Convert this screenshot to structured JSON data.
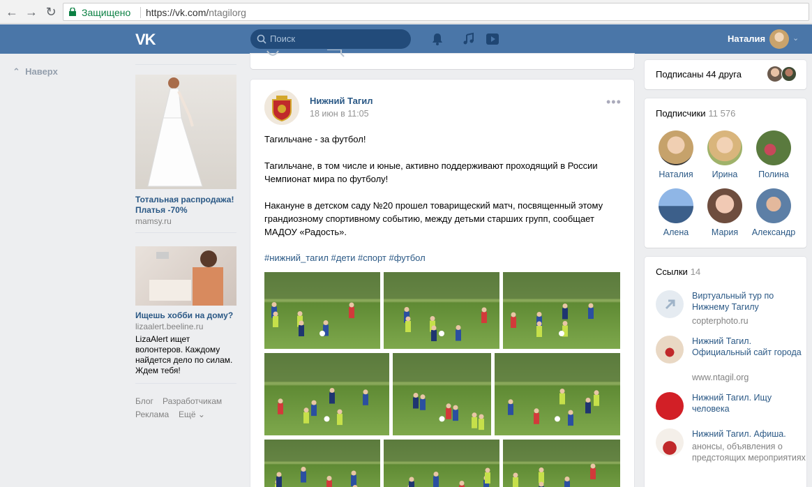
{
  "browser": {
    "secure_label": "Защищено",
    "url_host": "https://vk.com/",
    "url_path": "ntagilorg"
  },
  "header": {
    "logo": "VK",
    "search_placeholder": "Поиск",
    "user_name": "Наталия"
  },
  "leftnav": {
    "up_label": "Наверх"
  },
  "ads": [
    {
      "title": "Тотальная распродажа! Платья -70%",
      "domain": "mamsy.ru",
      "text": ""
    },
    {
      "title": "Ищешь хобби на дому?",
      "domain": "lizaalert.beeline.ru",
      "text": "LizaAlert ищет волонтеров. Каждому найдется дело по силам. Ждем тебя!"
    }
  ],
  "footer": {
    "blog": "Блог",
    "developers": "Разработчикам",
    "ads": "Реклама",
    "more": "Ещё"
  },
  "post": {
    "author": "Нижний Тагил",
    "date": "18 июн в 11:05",
    "more": "•••",
    "paragraphs": [
      "Тагильчане - за футбол!",
      "Тагильчане, в том числе и юные, активно поддерживают проходящий в России Чемпионат мира по футболу!",
      "Накануне в детском саду №20 прошел товарищеский матч, посвященный этому грандиозному спортивному событию, между детьми старших групп, сообщает МАДОУ «Радость»."
    ],
    "hashtags": "#нижний_тагил #дети #спорт #футбол",
    "photo_count": 9
  },
  "friends": {
    "label": "Подписаны 44 друга"
  },
  "subscribers": {
    "label": "Подписчики",
    "count": "11 576",
    "people": [
      "Наталия",
      "Ирина",
      "Полина",
      "Алена",
      "Мария",
      "Александр"
    ]
  },
  "links": {
    "label": "Ссылки",
    "count": "14",
    "items": [
      {
        "title": "Виртуальный тур по Нижнему Тагилу",
        "desc": "copterphoto.ru"
      },
      {
        "title": "Нижний Тагил. Официальный сайт города",
        "desc": "www.ntagil.org"
      },
      {
        "title": "Нижний Тагил. Ищу человека",
        "desc": ""
      },
      {
        "title": "Нижний Тагил. Афиша.",
        "desc": "анонсы, объявления о предстоящих мероприятиях"
      }
    ]
  },
  "colors": {
    "vk_blue": "#4a76a8",
    "link": "#2a5885",
    "bg": "#edeef0"
  }
}
